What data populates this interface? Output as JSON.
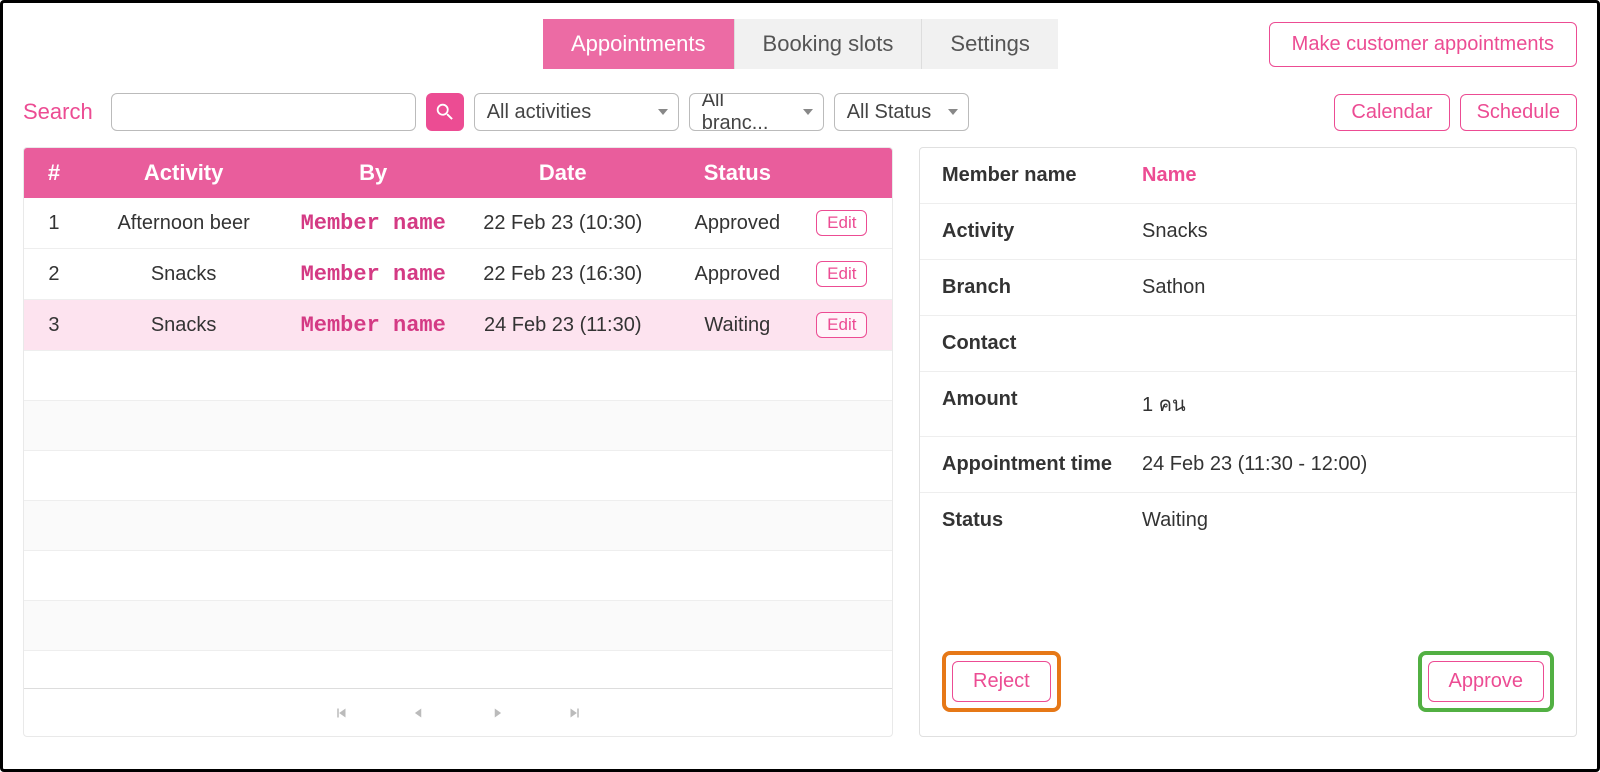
{
  "tabs": [
    {
      "label": "Appointments",
      "active": true
    },
    {
      "label": "Booking slots",
      "active": false
    },
    {
      "label": "Settings",
      "active": false
    }
  ],
  "make_btn": "Make customer appointments",
  "search": {
    "label": "Search",
    "value": ""
  },
  "filters": {
    "activities": "All activities",
    "branches": "All branc...",
    "status": "All Status"
  },
  "view_btns": {
    "calendar": "Calendar",
    "schedule": "Schedule"
  },
  "table": {
    "headers": {
      "idx": "#",
      "activity": "Activity",
      "by": "By",
      "date": "Date",
      "status": "Status"
    },
    "edit_label": "Edit",
    "rows": [
      {
        "idx": "1",
        "activity": "Afternoon beer",
        "by": "Member name",
        "date": "22 Feb 23 (10:30)",
        "status": "Approved",
        "selected": false
      },
      {
        "idx": "2",
        "activity": "Snacks",
        "by": "Member name",
        "date": "22 Feb 23 (16:30)",
        "status": "Approved",
        "selected": false
      },
      {
        "idx": "3",
        "activity": "Snacks",
        "by": "Member name",
        "date": "24 Feb 23 (11:30)",
        "status": "Waiting",
        "selected": true
      }
    ]
  },
  "detail": {
    "labels": {
      "member_name": "Member name",
      "activity": "Activity",
      "branch": "Branch",
      "contact": "Contact",
      "amount": "Amount",
      "appointment_time": "Appointment time",
      "status": "Status"
    },
    "values": {
      "member_name": "Name",
      "activity": "Snacks",
      "branch": "Sathon",
      "contact": "",
      "amount": "1 คน",
      "appointment_time": "24 Feb 23 (11:30 - 12:00)",
      "status": "Waiting"
    },
    "reject": "Reject",
    "approve": "Approve"
  }
}
